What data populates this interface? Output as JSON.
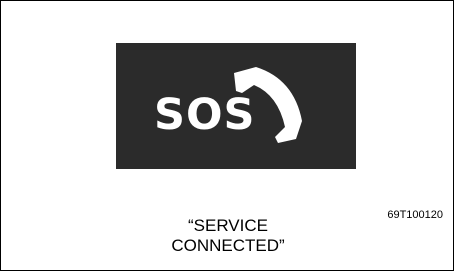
{
  "figure": {
    "icon_text": "SOS",
    "icon_symbol": "phone-handset-icon",
    "panel_color": "#2b2b2b",
    "icon_color": "#ffffff",
    "reference_code": "69T100120",
    "caption_line1": "“SERVICE",
    "caption_line2": "CONNECTED”"
  }
}
